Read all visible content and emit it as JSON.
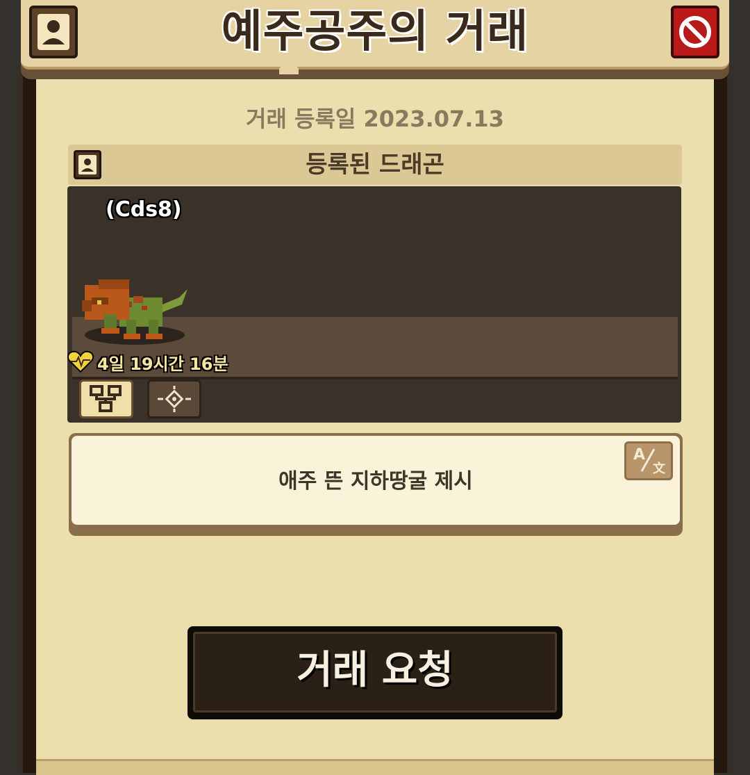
{
  "header": {
    "title": "예주공주의 거래",
    "profile_icon": "person-icon",
    "block_icon": "no-entry-icon",
    "block_color": "#b81a1a"
  },
  "trade": {
    "registered_date": "거래 등록일 2023.07.13"
  },
  "dragon_section": {
    "title": "등록된 드래곤",
    "dragon_name": "(Cds8)",
    "lifetime": "4일 19시간 16분",
    "heart_color": "#f2d23c",
    "buttons": [
      "family-tree-icon",
      "target-icon"
    ]
  },
  "message": {
    "text": "애주 뜬 지하땅굴 제시",
    "translate_icon": "translate-icon",
    "translate_a": "A",
    "translate_b": "文"
  },
  "actions": {
    "trade_request": "거래 요청"
  }
}
